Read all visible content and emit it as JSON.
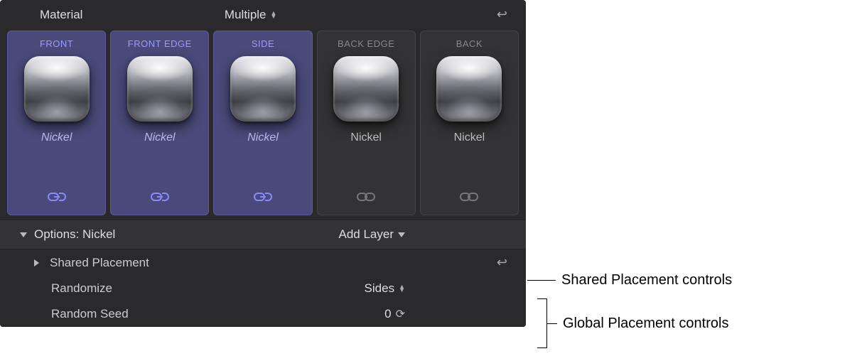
{
  "header": {
    "title": "Material",
    "preset": "Multiple"
  },
  "facets": [
    {
      "label": "FRONT",
      "material": "Nickel",
      "selected": true,
      "linked": true
    },
    {
      "label": "FRONT EDGE",
      "material": "Nickel",
      "selected": true,
      "linked": true
    },
    {
      "label": "SIDE",
      "material": "Nickel",
      "selected": true,
      "linked": true
    },
    {
      "label": "BACK EDGE",
      "material": "Nickel",
      "selected": false,
      "linked": false
    },
    {
      "label": "BACK",
      "material": "Nickel",
      "selected": false,
      "linked": false
    }
  ],
  "options": {
    "heading": "Options: Nickel",
    "add_layer_label": "Add Layer",
    "shared_placement_label": "Shared Placement",
    "randomize": {
      "label": "Randomize",
      "value": "Sides"
    },
    "random_seed": {
      "label": "Random Seed",
      "value": "0"
    }
  },
  "annotations": {
    "shared": "Shared Placement controls",
    "global": "Global Placement controls"
  }
}
